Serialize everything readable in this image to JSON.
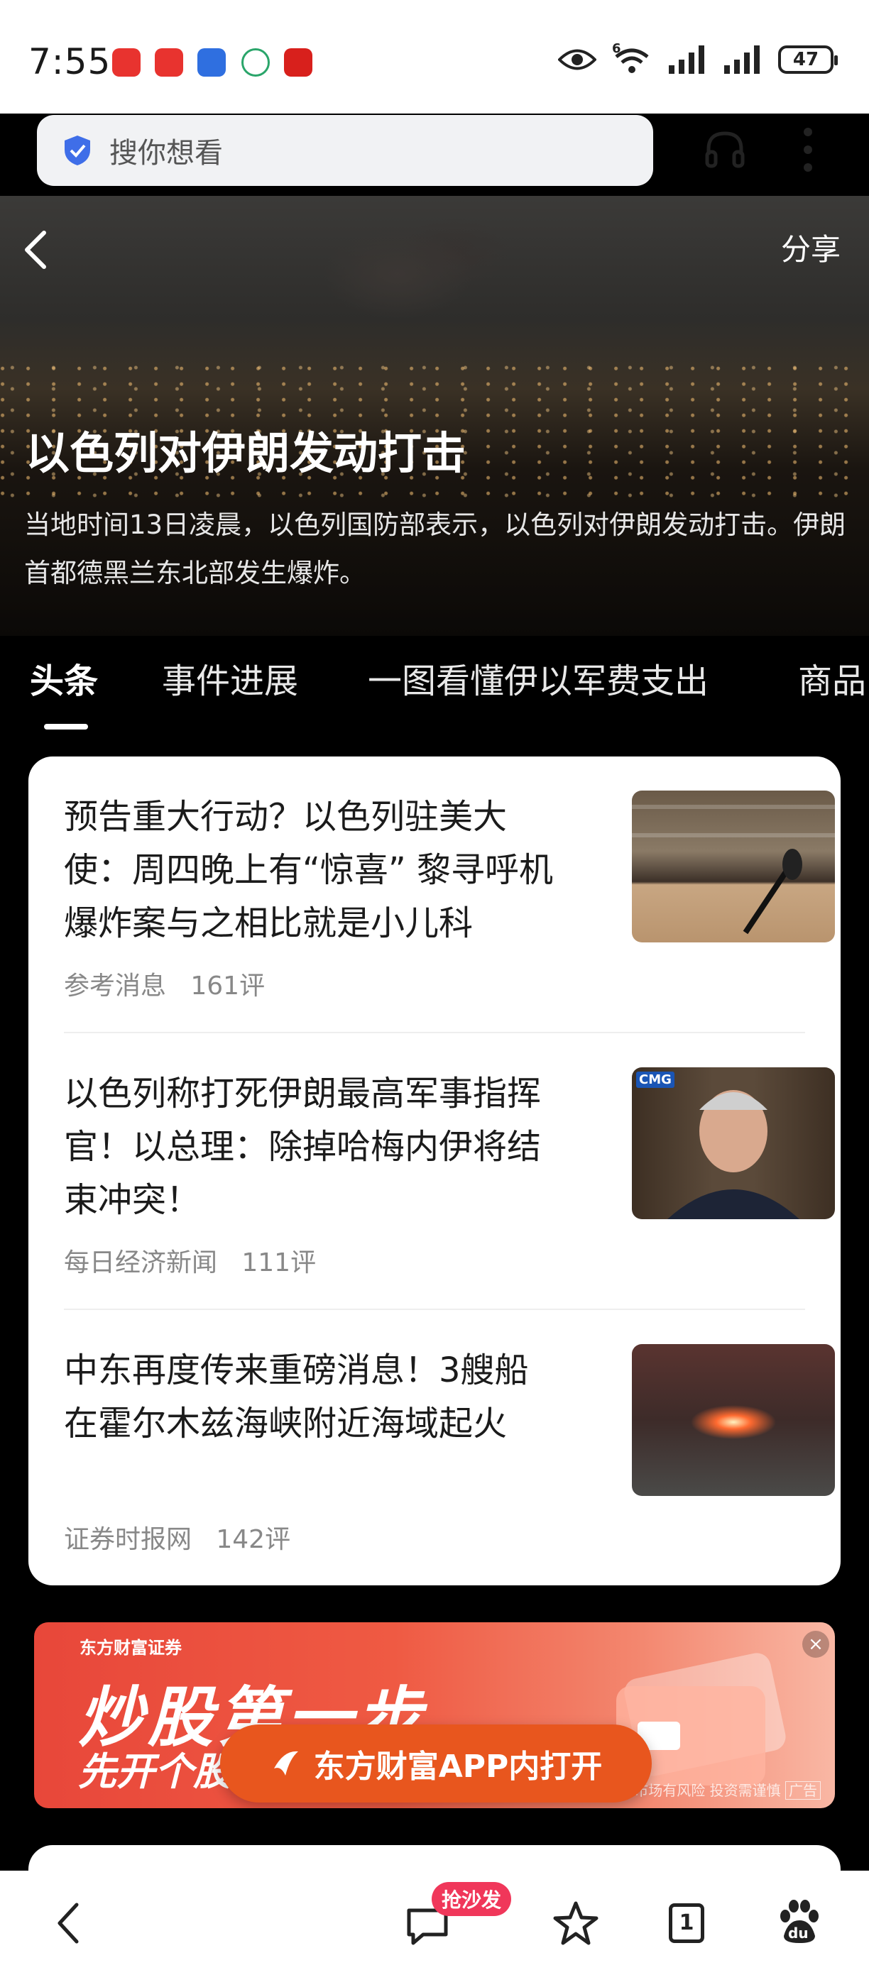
{
  "status_bar": {
    "time": "7:55",
    "network_label": "6",
    "battery": "47",
    "notification_icons": [
      "app-red-1-icon",
      "app-red-2-icon",
      "app-blue-icon",
      "app-green-icon",
      "app-red-3-icon"
    ]
  },
  "search": {
    "placeholder": "搜你想看"
  },
  "header": {
    "share_label": "分享"
  },
  "hero": {
    "title": "以色列对伊朗发动打击",
    "description": "当地时间13日凌晨，以色列国防部表示，以色列对伊朗发动打击。伊朗首都德黑兰东北部发生爆炸。"
  },
  "tabs": [
    {
      "label": "头条",
      "active": true
    },
    {
      "label": "事件进展",
      "active": false
    },
    {
      "label": "一图看懂伊以军费支出",
      "active": false
    },
    {
      "label": "商品",
      "active": false
    }
  ],
  "news": [
    {
      "title": "预告重大行动？以色列驻美大使：周四晚上有“惊喜” 黎寻呼机爆炸案与之相比就是小儿科",
      "source": "参考消息",
      "comments": "161评"
    },
    {
      "title": "以色列称打死伊朗最高军事指挥官！以总理：除掉哈梅内伊将结束冲突！",
      "source": "每日经济新闻",
      "comments": "111评"
    },
    {
      "title": "中东再度传来重磅消息！3艘船在霍尔木兹海峡附近海域起火",
      "source": "证券时报网",
      "comments": "142评"
    }
  ],
  "thumb_badges": {
    "cmg": "CMG"
  },
  "ad": {
    "brand": "东方财富证券",
    "headline": "炒股第一步",
    "subline": "先开个股",
    "disclaimer": "市场有风险 投资需谨慎",
    "tag": "广告",
    "close": "×",
    "open_app_label": "东方财富APP内打开",
    "accent": "#e8561e"
  },
  "bottom_bar": {
    "comment_badge": "抢沙发",
    "tab_count": "1",
    "baidu_label": "du",
    "badge_color": "#f0375a"
  }
}
